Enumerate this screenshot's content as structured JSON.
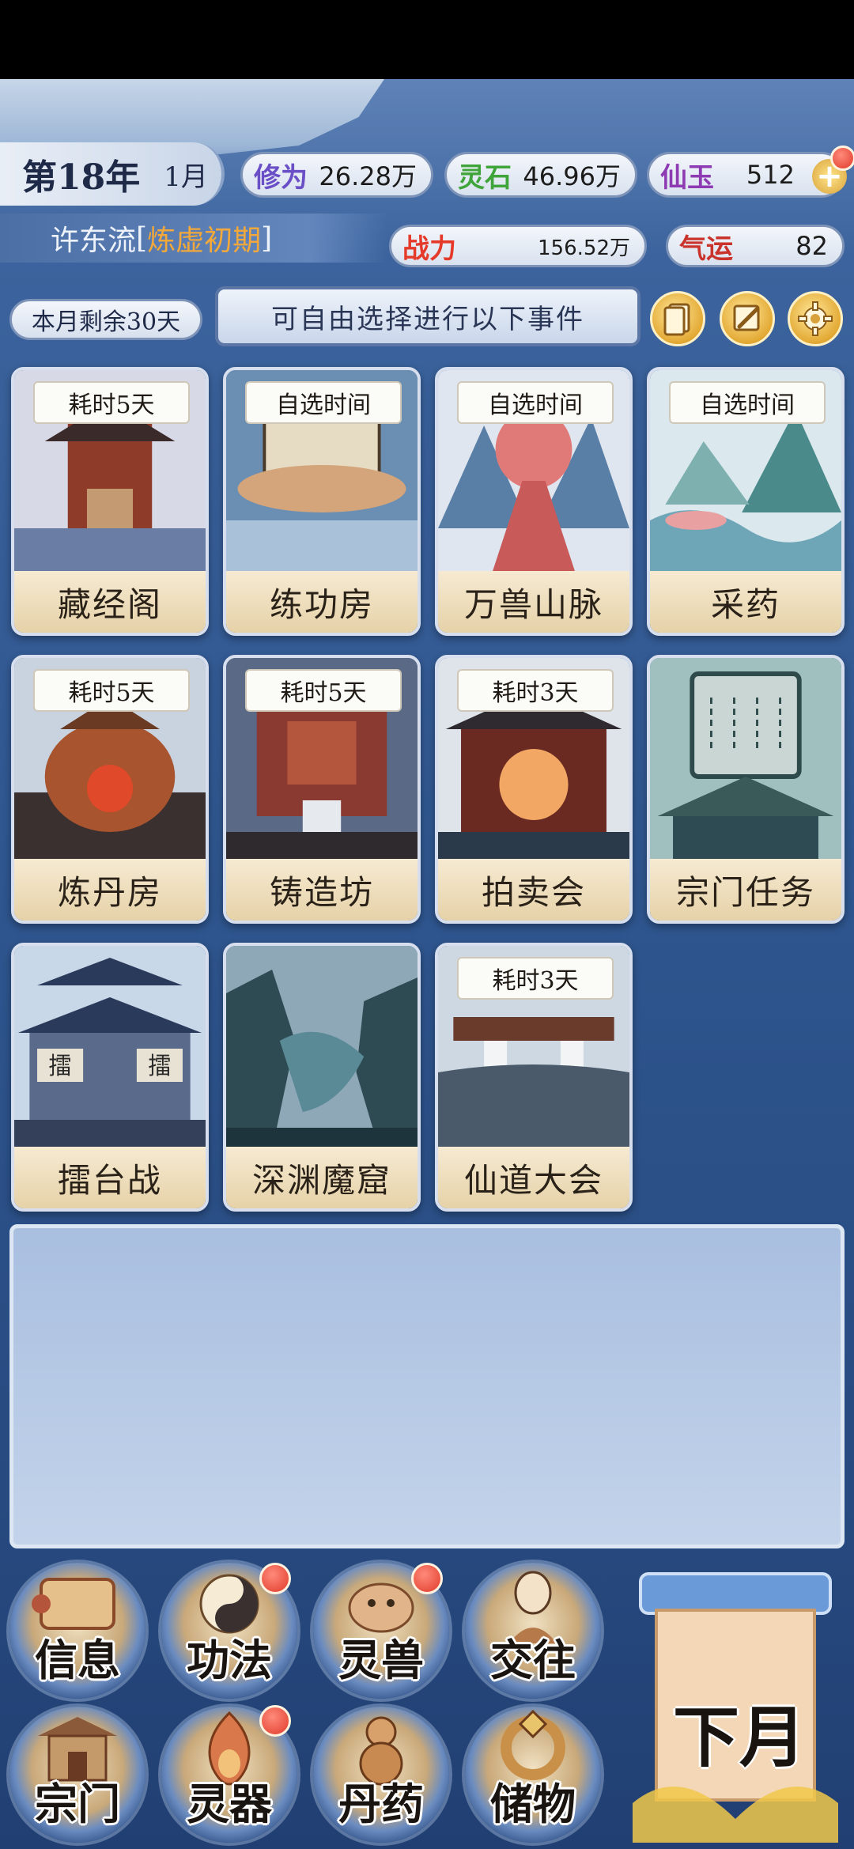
{
  "header": {
    "year": "第18年",
    "month": "1月",
    "cultivation": {
      "label": "修为",
      "value": "26.28万"
    },
    "spirit_stones": {
      "label": "灵石",
      "value": "46.96万"
    },
    "jade": {
      "label": "仙玉",
      "value": "512"
    },
    "player_name": "许东流",
    "realm_open": "[",
    "realm": "炼虚初期",
    "realm_close": "]",
    "combat": {
      "label": "战力",
      "value": "156.52万"
    },
    "luck": {
      "label": "气运",
      "value": "82"
    }
  },
  "info_bar": {
    "days_left": "本月剩余30天",
    "prompt": "可自由选择进行以下事件"
  },
  "locations": [
    {
      "name": "藏经阁",
      "tag": "耗时5天"
    },
    {
      "name": "练功房",
      "tag": "自选时间"
    },
    {
      "name": "万兽山脉",
      "tag": "自选时间"
    },
    {
      "name": "采药",
      "tag": "自选时间"
    },
    {
      "name": "炼丹房",
      "tag": "耗时5天"
    },
    {
      "name": "铸造坊",
      "tag": "耗时5天"
    },
    {
      "name": "拍卖会",
      "tag": "耗时3天"
    },
    {
      "name": "宗门任务",
      "tag": ""
    },
    {
      "name": "擂台战",
      "tag": ""
    },
    {
      "name": "深渊魔窟",
      "tag": ""
    },
    {
      "name": "仙道大会",
      "tag": "耗时3天"
    }
  ],
  "card_art_fragments": {
    "sign_left": "擂",
    "sign_right": "擂"
  },
  "nav": [
    {
      "label": "信息",
      "icon": "scroll-icon",
      "badge": false
    },
    {
      "label": "功法",
      "icon": "yin-yang-icon",
      "badge": true
    },
    {
      "label": "灵兽",
      "icon": "beast-icon",
      "badge": true
    },
    {
      "label": "交往",
      "icon": "person-icon",
      "badge": false
    },
    {
      "label": "宗门",
      "icon": "gate-icon",
      "badge": false
    },
    {
      "label": "灵器",
      "icon": "flame-icon",
      "badge": true
    },
    {
      "label": "丹药",
      "icon": "gourd-icon",
      "badge": false
    },
    {
      "label": "储物",
      "icon": "ring-icon",
      "badge": false
    }
  ],
  "next_month": "下月",
  "colors": {
    "cultivation_label": "#6a4fc7",
    "stones_label": "#3fa53a",
    "jade_label": "#8e3bb3",
    "combat_label": "#e53a2a",
    "luck_label": "#c9332b",
    "realm": "#f2a83a"
  }
}
